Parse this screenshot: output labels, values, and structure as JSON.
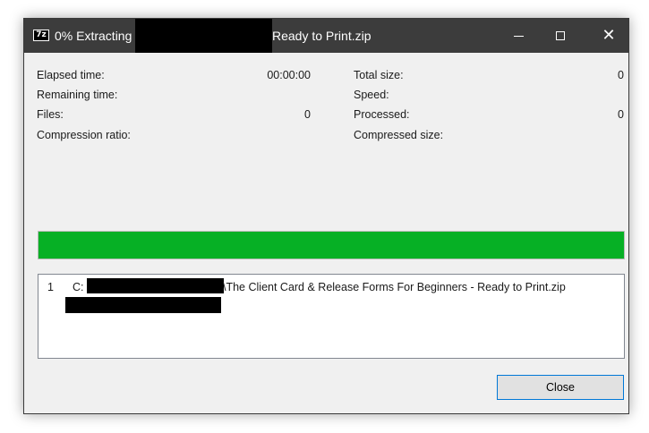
{
  "window": {
    "title_prefix": "0% Extracting",
    "title_suffix": "Ready to Print.zip",
    "app_icon_text": "7z",
    "minimize_glyph": "",
    "close_glyph": "✕"
  },
  "stats": {
    "elapsed_time_label": "Elapsed time:",
    "elapsed_time_value": "00:00:00",
    "remaining_time_label": "Remaining time:",
    "remaining_time_value": "",
    "files_label": "Files:",
    "files_value": "0",
    "compression_ratio_label": "Compression ratio:",
    "compression_ratio_value": "",
    "total_size_label": "Total size:",
    "total_size_value": "0",
    "speed_label": "Speed:",
    "speed_value": "",
    "processed_label": "Processed:",
    "processed_value": "0",
    "compressed_size_label": "Compressed size:",
    "compressed_size_value": ""
  },
  "progress": {
    "fraction": 1.0,
    "color": "#06b025"
  },
  "file_list": {
    "items": [
      {
        "index": "1",
        "path_prefix": "C:",
        "path_suffix": "\\The Client Card & Release Forms For Beginners - Ready to Print.zip"
      }
    ]
  },
  "buttons": {
    "close_label": "Close"
  }
}
